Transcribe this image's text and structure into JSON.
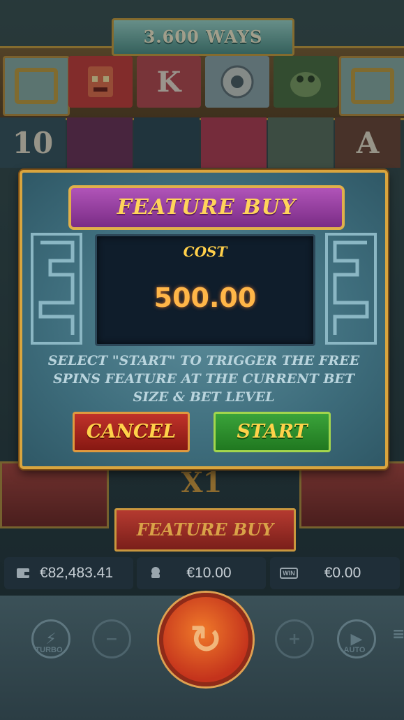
{
  "banner": {
    "ways": "3.600 WAYS"
  },
  "reels": {
    "top_row": [
      {
        "name": "mask",
        "label": ""
      },
      {
        "name": "king",
        "label": "K"
      },
      {
        "name": "sun",
        "label": ""
      },
      {
        "name": "frog",
        "label": ""
      }
    ],
    "row_two": [
      {
        "label": "10"
      },
      {
        "label": ""
      },
      {
        "label": ""
      },
      {
        "label": ""
      },
      {
        "label": ""
      },
      {
        "label": "A"
      }
    ]
  },
  "modal": {
    "title": "FEATURE BUY",
    "cost_label": "COST",
    "cost_value": "500.00",
    "instruction": "SELECT \"START\" TO TRIGGER THE FREE SPINS FEATURE AT THE CURRENT BET SIZE & BET LEVEL",
    "cancel_label": "CANCEL",
    "start_label": "START"
  },
  "multiplier": "X1",
  "feature_buy_label": "FEATURE BUY",
  "stats": {
    "balance": "€82,483.41",
    "bet": "€10.00",
    "win": "€0.00",
    "win_icon_label": "WIN"
  },
  "controls": {
    "turbo": "TURBO",
    "auto": "AUTO"
  },
  "colors": {
    "modal_border": "#d9a53e",
    "title_bg": "#9a40a4",
    "cancel": "#b0281f",
    "start": "#2d8f2d",
    "spin": "#d8462a"
  }
}
